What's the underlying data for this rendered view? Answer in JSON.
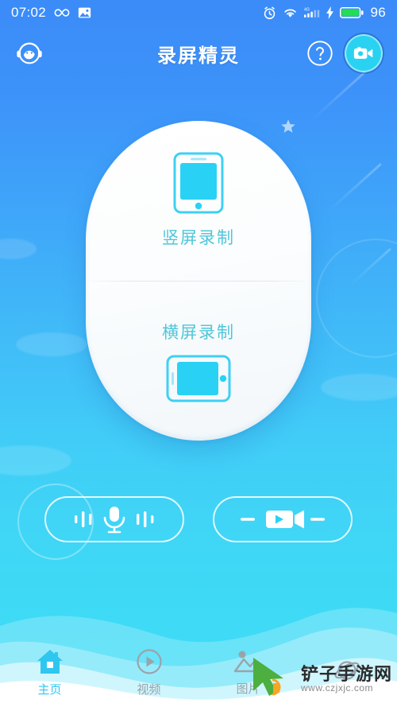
{
  "statusbar": {
    "time": "07:02",
    "battery_percent": "96",
    "icons": {
      "infinity": "infinity-icon",
      "photo": "photo-icon",
      "alarm": "alarm-clock-icon",
      "wifi": "wifi-icon",
      "signal": "signal-4g-icon",
      "signal_label": "4G",
      "charging": "charging-bolt-icon",
      "battery": "battery-icon"
    },
    "colors": {
      "battery_fill": "#22dd55",
      "text": "#ffffff"
    }
  },
  "header": {
    "title": "录屏精灵",
    "support_icon": "headset-face-icon",
    "help_icon": "question-mark-icon",
    "record_icon": "video-camera-icon",
    "record_button_color": "#2ad2f2"
  },
  "card": {
    "portrait": {
      "label": "竖屏录制",
      "icon": "phone-portrait-icon"
    },
    "landscape": {
      "label": "横屏录制",
      "icon": "phone-landscape-icon"
    },
    "accent_color": "#4fc6d9",
    "screen_color": "#29d2f5"
  },
  "actions": {
    "mic": {
      "icon": "microphone-icon",
      "name": "audio-record-button"
    },
    "video": {
      "icon": "video-record-icon",
      "name": "video-record-button"
    }
  },
  "bottomnav": {
    "items": [
      {
        "label": "主页",
        "icon": "home-icon",
        "active": true
      },
      {
        "label": "视频",
        "icon": "play-circle-icon",
        "active": false
      },
      {
        "label": "图片",
        "icon": "image-mountain-icon",
        "active": false
      },
      {
        "label": "",
        "icon": "planet-icon",
        "active": false
      }
    ],
    "active_color": "#2fc7ef",
    "inactive_color": "#9aa3ac"
  },
  "watermark": {
    "title": "铲子手游网",
    "url": "www.czjxjc.com",
    "cursor_icon": "cursor-arrow-icon"
  },
  "background": {
    "gradient_top": "#3b8bf8",
    "gradient_bottom": "#3fdcf6"
  }
}
